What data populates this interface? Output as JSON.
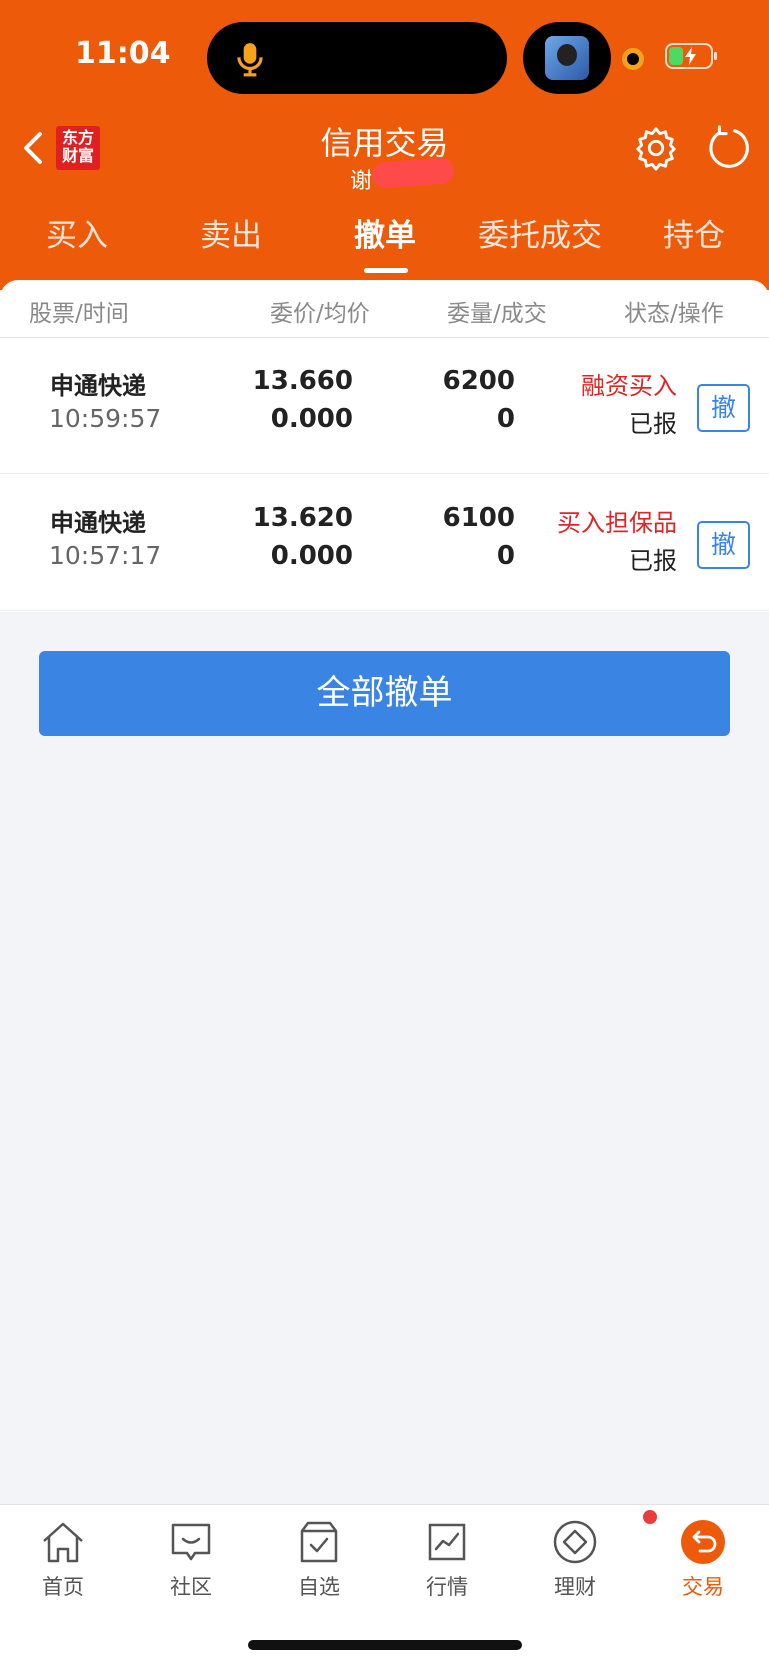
{
  "status_bar": {
    "time": "11:04"
  },
  "header": {
    "logo_line1": "东方",
    "logo_line2": "财富",
    "title": "信用交易",
    "subtitle": "谢"
  },
  "tabs": [
    {
      "label": "买入"
    },
    {
      "label": "卖出"
    },
    {
      "label": "撤单"
    },
    {
      "label": "委托成交"
    },
    {
      "label": "持仓"
    }
  ],
  "table": {
    "headers": [
      "股票/时间",
      "委价/均价",
      "委量/成交",
      "状态/操作"
    ],
    "rows": [
      {
        "name": "申通快递",
        "time": "10:59:57",
        "price": "13.660",
        "avg_price": "0.000",
        "qty": "6200",
        "filled": "0",
        "type": "融资买入",
        "status": "已报",
        "action": "撤"
      },
      {
        "name": "申通快递",
        "time": "10:57:17",
        "price": "13.620",
        "avg_price": "0.000",
        "qty": "6100",
        "filled": "0",
        "type": "买入担保品",
        "status": "已报",
        "action": "撤"
      }
    ]
  },
  "cancel_all_label": "全部撤单",
  "bottom_nav": [
    {
      "label": "首页",
      "icon": "home-icon"
    },
    {
      "label": "社区",
      "icon": "chat-icon"
    },
    {
      "label": "自选",
      "icon": "watchlist-icon"
    },
    {
      "label": "行情",
      "icon": "market-chart-icon"
    },
    {
      "label": "理财",
      "icon": "diamond-icon"
    },
    {
      "label": "交易",
      "icon": "trade-icon"
    }
  ],
  "colors": {
    "brand_orange": "#ed5b0a",
    "action_blue": "#3a84e4",
    "alert_red": "#e02424"
  }
}
